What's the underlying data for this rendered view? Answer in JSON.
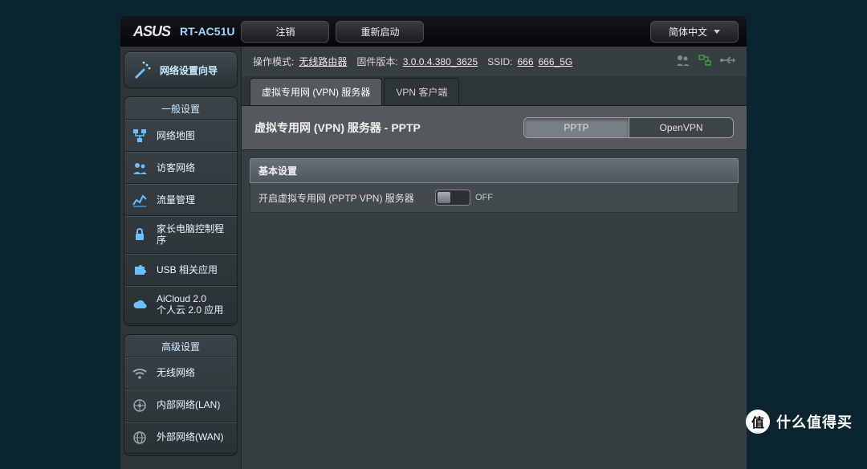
{
  "brand": "ASUS",
  "model": "RT-AC51U",
  "top_buttons": {
    "logout": "注销",
    "reboot": "重新启动"
  },
  "language": "简体中文",
  "status": {
    "mode_label": "操作模式:",
    "mode_value": "无线路由器",
    "fw_label": "固件版本:",
    "fw_value": "3.0.0.4.380_3625",
    "ssid_label": "SSID:",
    "ssid1": "666",
    "ssid2": "666_5G"
  },
  "wizard": "网络设置向导",
  "general_title": "一般设置",
  "general_items": [
    "网络地图",
    "访客网络",
    "流量管理",
    "家长电脑控制程序",
    "USB 相关应用",
    "AiCloud 2.0\n个人云 2.0 应用"
  ],
  "advanced_title": "高级设置",
  "advanced_items": [
    "无线网络",
    "内部网络(LAN)",
    "外部网络(WAN)"
  ],
  "tabs": {
    "server": "虚拟专用网 (VPN) 服务器",
    "client": "VPN 客户端"
  },
  "page_title": "虚拟专用网 (VPN) 服务器 - PPTP",
  "type_tabs": {
    "pptp": "PPTP",
    "openvpn": "OpenVPN"
  },
  "section_basic": "基本设置",
  "enable_label": "开启虚拟专用网 (PPTP VPN) 服务器",
  "toggle_state": "OFF",
  "watermark": {
    "badge": "值",
    "text": "什么值得买"
  }
}
